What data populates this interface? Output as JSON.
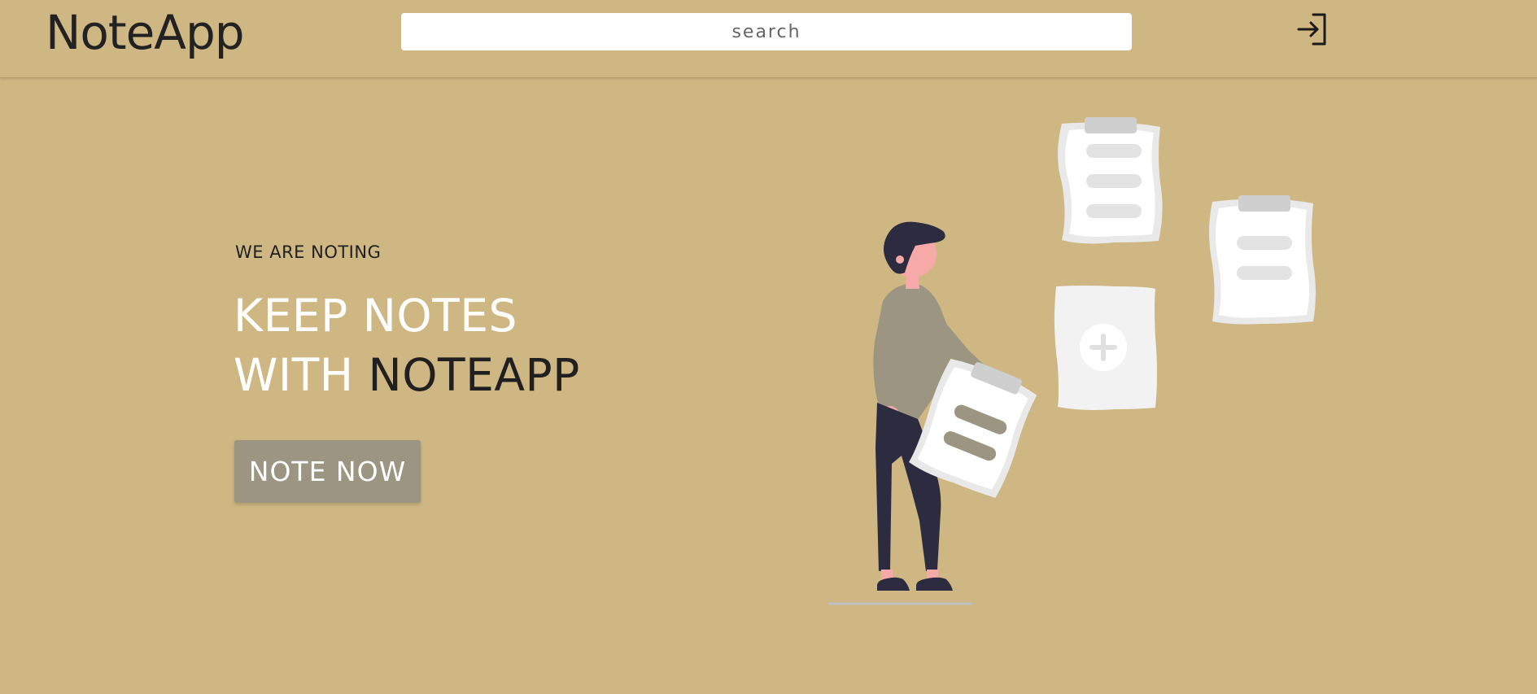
{
  "navbar": {
    "brand": "NoteApp",
    "search": {
      "placeholder": "search",
      "value": ""
    },
    "login_icon": "sign-in-icon"
  },
  "hero": {
    "kicker": "WE ARE NOTING",
    "title_line1": "KEEP NOTES",
    "title_line2_prefix": "WITH ",
    "title_line2_highlight": "NOTEAPP",
    "cta_label": "NOTE NOW"
  },
  "illustration": {
    "description_icon": "person-holding-notes-illustration"
  },
  "colors": {
    "background": "#cfb783",
    "button": "#9b9582",
    "text_dark": "#202020",
    "text_light": "#ffffff"
  }
}
